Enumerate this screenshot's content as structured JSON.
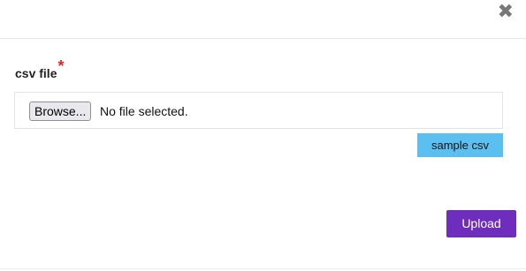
{
  "dialog": {
    "close_symbol": "✖"
  },
  "form": {
    "field_label": "csv file",
    "required_mark": "*",
    "browse_label": "Browse...",
    "file_status": "No file selected.",
    "sample_label": "sample csv",
    "upload_label": "Upload"
  },
  "colors": {
    "required": "#e3262b",
    "sample_button": "#5bc0f0",
    "upload_button": "#6f2dbd"
  }
}
